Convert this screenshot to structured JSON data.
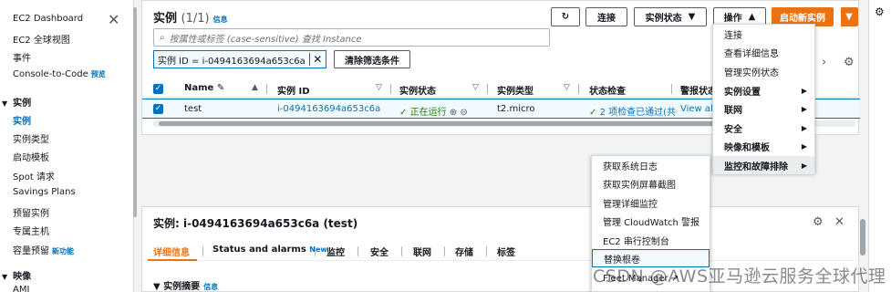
{
  "sidebar": {
    "dashboard": "EC2 Dashboard",
    "global_view": "EC2 全球视图",
    "events": "事件",
    "console_to_code": "Console-to-Code",
    "console_to_code_badge": "预览",
    "instances_section": "实例",
    "instances": "实例",
    "instance_types": "实例类型",
    "launch_templates": "启动模板",
    "spot_requests": "Spot 请求",
    "savings_plans": "Savings Plans",
    "reserved_instances": "预留实例",
    "dedicated_hosts": "专属主机",
    "capacity_reservations": "容量预留",
    "capacity_badge": "新功能",
    "images_section": "映像",
    "ami": "AMI"
  },
  "header": {
    "title": "实例",
    "count": "(1/1)",
    "info": "信息",
    "refresh_icon": "refresh-icon",
    "connect": "连接",
    "instance_state": "实例状态",
    "actions": "操作",
    "launch": "启动新实例"
  },
  "search": {
    "placeholder": "按属性或标签 (case-sensitive) 查找 Instance",
    "token": "实例 ID = i-0494163694a653c6a",
    "clear": "清除筛选条件"
  },
  "table": {
    "headers": [
      "Name",
      "实例 ID",
      "实例状态",
      "实例类型",
      "状态检查",
      "警报状态"
    ],
    "row": {
      "name": "test",
      "id": "i-0494163694a653c6a",
      "state": "正在运行",
      "type": "t2.micro",
      "checks": "2 项检查已通过(共",
      "alarm": "View ala"
    }
  },
  "actions_menu": {
    "items": [
      "连接",
      "查看详细信息",
      "管理实例状态",
      "实例设置",
      "联网",
      "安全",
      "映像和模板",
      "监控和故障排除"
    ]
  },
  "monitor_submenu": {
    "items": [
      "获取系统日志",
      "获取实例屏幕截图",
      "管理详细监控",
      "管理 CloudWatch 警报",
      "EC2 串行控制台",
      "替换根卷",
      "Fleet Manager"
    ]
  },
  "details": {
    "title": "实例: i-0494163694a653c6a (test)",
    "tabs": [
      "详细信息",
      "Status and alarms",
      "监控",
      "安全",
      "联网",
      "存储",
      "标签"
    ],
    "tab_new": "New",
    "summary": "实例摘要",
    "summary_info": "信息"
  },
  "watermark": "CSDN @AWS亚马逊云服务全球代理",
  "colors": {
    "accent": "#ec7211",
    "link": "#0073bb",
    "success": "#1d8102"
  }
}
